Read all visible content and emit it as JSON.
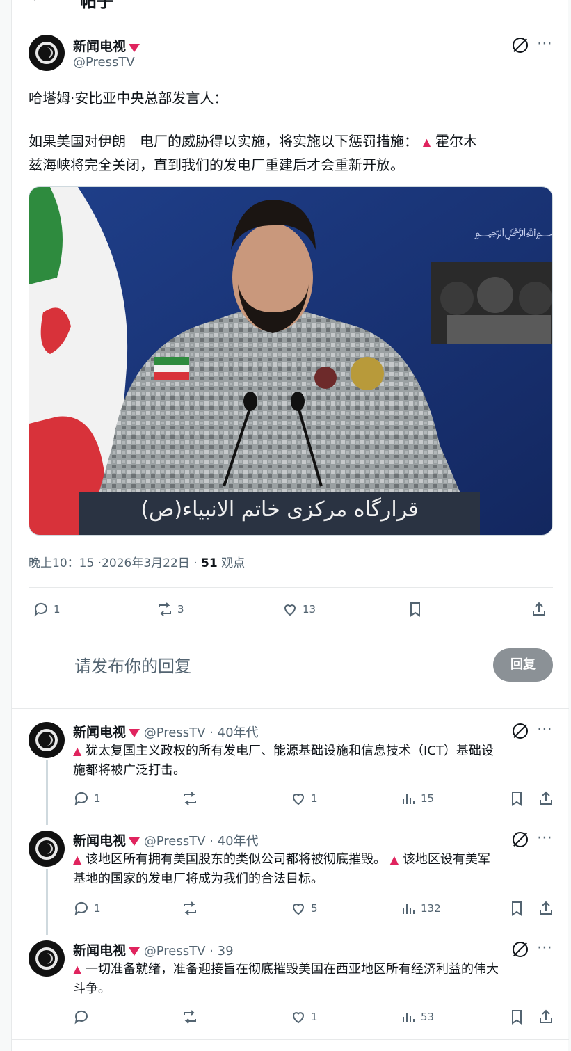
{
  "header": {
    "back_icon": "back-arrow-icon",
    "title": "帖子"
  },
  "main_post": {
    "name": "新闻电视",
    "handle": "@PressTV",
    "line1": "哈塔姆·安比亚中央总部发言人：",
    "line2": "如果美国对伊朗",
    "line2b": "电厂的威胁得以实施，将实施以下惩罚措施：",
    "line2c": "霍尔木",
    "line3": "兹海峡将完全关闭，直到我们的发电厂重建后才会重新开放。",
    "image_banner_text": "قرارگاه مرکزی خاتم الانبیاء(ص)",
    "time": "晚上10：15",
    "date": "·2026年3月22日 ·",
    "views": "51",
    "views_label": "观点",
    "stats": {
      "replies": "1",
      "reposts": "3",
      "likes": "13"
    }
  },
  "composer": {
    "placeholder": "请发布你的回复",
    "button": "回复"
  },
  "replies": [
    {
      "name": "新闻电视",
      "handle": "@PressTV",
      "age": "· 40年代",
      "line1": "犹太复国主义政权的所有发电厂、能源基础设施和信息技术（ICT）基础设",
      "line2": "施都将被广泛打击。",
      "stats": {
        "replies": "1",
        "reposts": "",
        "likes": "1",
        "views": "15"
      }
    },
    {
      "name": "新闻电视",
      "handle": "@PressTV",
      "age": "· 40年代",
      "line1a": "该地区所有拥有美国股东的类似公司都将被彻底摧毁。",
      "line1b": "该地区设有美军",
      "line2": "基地的国家的发电厂将成为我们的合法目标。",
      "stats": {
        "replies": "1",
        "reposts": "",
        "likes": "5",
        "views": "132"
      }
    },
    {
      "name": "新闻电视",
      "handle": "@PressTV",
      "age": "· 39",
      "line1": "一切准备就绪，准备迎接旨在彻底摧毁美国在西亚地区所有经济利益的伟大",
      "line2": "斗争。",
      "stats": {
        "replies": "",
        "reposts": "",
        "likes": "1",
        "views": "53"
      }
    }
  ],
  "colors": {
    "accent_red": "#e0245e",
    "muted": "#536471",
    "reply_button": "#8b9196"
  }
}
